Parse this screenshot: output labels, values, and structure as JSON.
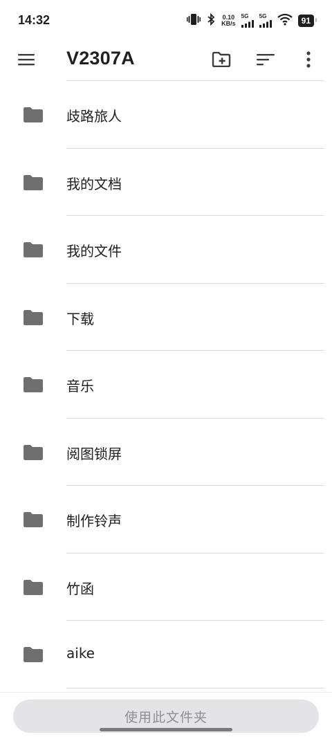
{
  "status_bar": {
    "time": "14:32",
    "net_speed_value": "0.10",
    "net_speed_unit": "KB/s",
    "signal1_label": "5G",
    "signal2_label": "5G",
    "battery": "91"
  },
  "app_bar": {
    "title": "V2307A",
    "menu_icon": "hamburger-menu-icon",
    "new_folder_icon": "create-new-folder-icon",
    "sort_icon": "sort-icon",
    "more_icon": "more-vert-icon"
  },
  "folders": [
    {
      "name": "歧路旅人",
      "icon": "folder-icon"
    },
    {
      "name": "我的文档",
      "icon": "folder-icon"
    },
    {
      "name": "我的文件",
      "icon": "folder-icon"
    },
    {
      "name": "下载",
      "icon": "folder-icon"
    },
    {
      "name": "音乐",
      "icon": "folder-icon"
    },
    {
      "name": "阅图锁屏",
      "icon": "folder-icon"
    },
    {
      "name": "制作铃声",
      "icon": "folder-icon"
    },
    {
      "name": "竹函",
      "icon": "folder-icon"
    },
    {
      "name": "aike",
      "icon": "folder-icon"
    }
  ],
  "footer": {
    "use_folder_label": "使用此文件夹"
  },
  "colors": {
    "icon_gray": "#6f6f6f",
    "text_dark": "#1f1f1f",
    "button_bg": "#e4e3e8",
    "button_text": "#8f8e94"
  }
}
